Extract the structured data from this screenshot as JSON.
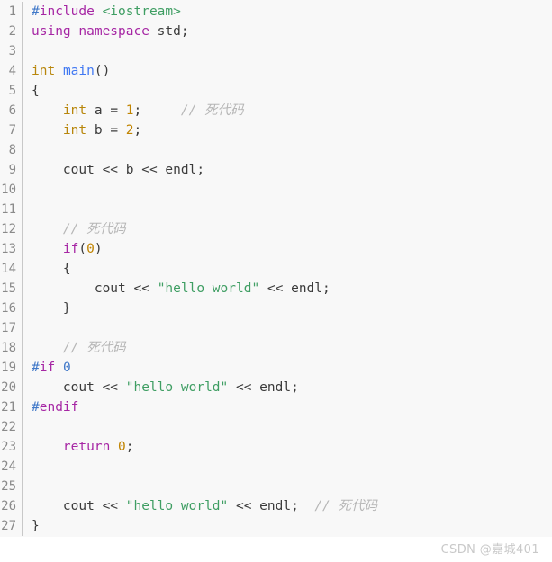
{
  "editor": {
    "language": "cpp",
    "background_color": "#f8f8f8",
    "gutter_color": "#8a8a8a",
    "first_line_number": 1,
    "last_line_number": 27,
    "lines": [
      {
        "n": "1",
        "tokens": [
          {
            "t": "#",
            "c": "hash"
          },
          {
            "t": "include",
            "c": "pre"
          },
          {
            "t": " ",
            "c": "plain"
          },
          {
            "t": "<iostream>",
            "c": "header"
          }
        ]
      },
      {
        "n": "2",
        "tokens": [
          {
            "t": "using namespace",
            "c": "keyword"
          },
          {
            "t": " std;",
            "c": "plain"
          }
        ]
      },
      {
        "n": "3",
        "tokens": []
      },
      {
        "n": "4",
        "tokens": [
          {
            "t": "int",
            "c": "type"
          },
          {
            "t": " ",
            "c": "plain"
          },
          {
            "t": "main",
            "c": "func"
          },
          {
            "t": "()",
            "c": "plain"
          }
        ]
      },
      {
        "n": "5",
        "tokens": [
          {
            "t": "{",
            "c": "plain"
          }
        ]
      },
      {
        "n": "6",
        "tokens": [
          {
            "t": "    ",
            "c": "plain"
          },
          {
            "t": "int",
            "c": "type"
          },
          {
            "t": " a = ",
            "c": "plain"
          },
          {
            "t": "1",
            "c": "number"
          },
          {
            "t": ";",
            "c": "plain"
          },
          {
            "t": "     ",
            "c": "plain"
          },
          {
            "t": "// 死代码",
            "c": "comment"
          }
        ]
      },
      {
        "n": "7",
        "tokens": [
          {
            "t": "    ",
            "c": "plain"
          },
          {
            "t": "int",
            "c": "type"
          },
          {
            "t": " b = ",
            "c": "plain"
          },
          {
            "t": "2",
            "c": "number"
          },
          {
            "t": ";",
            "c": "plain"
          }
        ]
      },
      {
        "n": "8",
        "tokens": []
      },
      {
        "n": "9",
        "tokens": [
          {
            "t": "    cout << b << endl;",
            "c": "plain"
          }
        ]
      },
      {
        "n": "10",
        "tokens": []
      },
      {
        "n": "11",
        "tokens": []
      },
      {
        "n": "12",
        "tokens": [
          {
            "t": "    ",
            "c": "plain"
          },
          {
            "t": "// 死代码",
            "c": "comment"
          }
        ]
      },
      {
        "n": "13",
        "tokens": [
          {
            "t": "    ",
            "c": "plain"
          },
          {
            "t": "if",
            "c": "keyword"
          },
          {
            "t": "(",
            "c": "plain"
          },
          {
            "t": "0",
            "c": "number"
          },
          {
            "t": ")",
            "c": "plain"
          }
        ]
      },
      {
        "n": "14",
        "tokens": [
          {
            "t": "    {",
            "c": "plain"
          }
        ]
      },
      {
        "n": "15",
        "tokens": [
          {
            "t": "        cout << ",
            "c": "plain"
          },
          {
            "t": "\"hello world\"",
            "c": "string"
          },
          {
            "t": " << endl;",
            "c": "plain"
          }
        ]
      },
      {
        "n": "16",
        "tokens": [
          {
            "t": "    }",
            "c": "plain"
          }
        ]
      },
      {
        "n": "17",
        "tokens": []
      },
      {
        "n": "18",
        "tokens": [
          {
            "t": "    ",
            "c": "plain"
          },
          {
            "t": "// 死代码",
            "c": "comment"
          }
        ]
      },
      {
        "n": "19",
        "tokens": [
          {
            "t": "#",
            "c": "hash"
          },
          {
            "t": "if",
            "c": "pre"
          },
          {
            "t": " ",
            "c": "plain"
          },
          {
            "t": "0",
            "c": "numblue"
          }
        ]
      },
      {
        "n": "20",
        "tokens": [
          {
            "t": "    cout << ",
            "c": "plain"
          },
          {
            "t": "\"hello world\"",
            "c": "string"
          },
          {
            "t": " << endl;",
            "c": "plain"
          }
        ]
      },
      {
        "n": "21",
        "tokens": [
          {
            "t": "#",
            "c": "hash"
          },
          {
            "t": "endif",
            "c": "pre"
          }
        ]
      },
      {
        "n": "22",
        "tokens": []
      },
      {
        "n": "23",
        "tokens": [
          {
            "t": "    ",
            "c": "plain"
          },
          {
            "t": "return",
            "c": "keyword"
          },
          {
            "t": " ",
            "c": "plain"
          },
          {
            "t": "0",
            "c": "number"
          },
          {
            "t": ";",
            "c": "plain"
          }
        ]
      },
      {
        "n": "24",
        "tokens": []
      },
      {
        "n": "25",
        "tokens": []
      },
      {
        "n": "26",
        "tokens": [
          {
            "t": "    cout << ",
            "c": "plain"
          },
          {
            "t": "\"hello world\"",
            "c": "string"
          },
          {
            "t": " << endl;",
            "c": "plain"
          },
          {
            "t": "  ",
            "c": "plain"
          },
          {
            "t": "// 死代码",
            "c": "comment"
          }
        ]
      },
      {
        "n": "27",
        "tokens": [
          {
            "t": "}",
            "c": "plain"
          }
        ]
      }
    ]
  },
  "watermark": {
    "text": "CSDN @嘉城401"
  }
}
